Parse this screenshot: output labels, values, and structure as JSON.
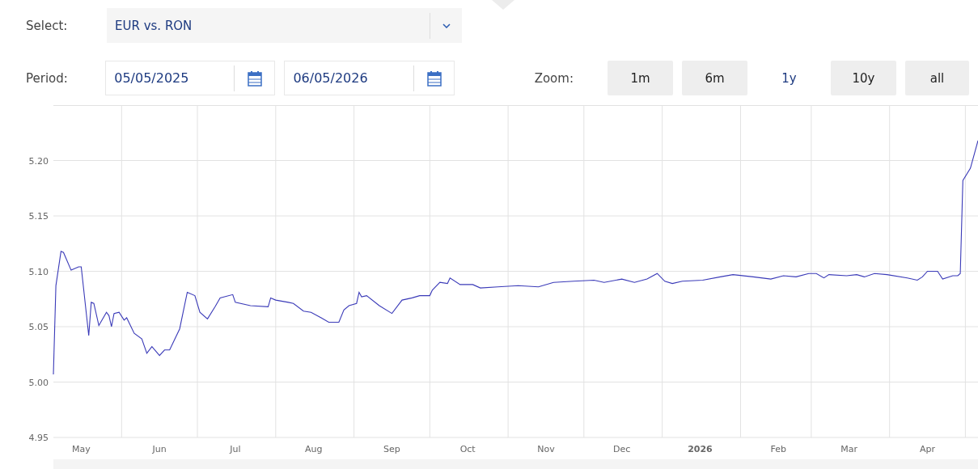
{
  "selector": {
    "label": "Select:",
    "value": "EUR vs. RON"
  },
  "period": {
    "label": "Period:",
    "from": "05/05/2025",
    "to": "06/05/2026"
  },
  "zoom": {
    "label": "Zoom:",
    "options": [
      {
        "label": "1m",
        "selected": false
      },
      {
        "label": "6m",
        "selected": false
      },
      {
        "label": "1y",
        "selected": true
      },
      {
        "label": "10y",
        "selected": false
      },
      {
        "label": "all",
        "selected": false
      }
    ]
  },
  "chart": {
    "chart_data": {
      "type": "line",
      "grid": true,
      "xlim": [
        "2025-05-05",
        "2026-05-06"
      ],
      "ylim": [
        4.95,
        5.25
      ],
      "yticks": [
        {
          "value": 4.95,
          "label": "4.95"
        },
        {
          "value": 5.0,
          "label": "5.00"
        },
        {
          "value": 5.05,
          "label": "5.05"
        },
        {
          "value": 5.1,
          "label": "5.10"
        },
        {
          "value": 5.15,
          "label": "5.15"
        },
        {
          "value": 5.2,
          "label": "5.20"
        }
      ],
      "xticks": [
        {
          "value": "2025-05-16",
          "label": "May"
        },
        {
          "value": "2025-06-16",
          "label": "Jun"
        },
        {
          "value": "2025-07-16",
          "label": "Jul"
        },
        {
          "value": "2025-08-16",
          "label": "Aug"
        },
        {
          "value": "2025-09-16",
          "label": "Sep"
        },
        {
          "value": "2025-10-16",
          "label": "Oct"
        },
        {
          "value": "2025-11-16",
          "label": "Nov"
        },
        {
          "value": "2025-12-16",
          "label": "Dec"
        },
        {
          "value": "2026-01-16",
          "label": "2026"
        },
        {
          "value": "2026-02-16",
          "label": "Feb"
        },
        {
          "value": "2026-03-16",
          "label": "Mar"
        },
        {
          "value": "2026-04-16",
          "label": "Apr"
        }
      ],
      "x": [
        "2025-05-05",
        "2025-05-06",
        "2025-05-08",
        "2025-05-09",
        "2025-05-12",
        "2025-05-15",
        "2025-05-16",
        "2025-05-19",
        "2025-05-20",
        "2025-05-21",
        "2025-05-23",
        "2025-05-26",
        "2025-05-27",
        "2025-05-28",
        "2025-05-29",
        "2025-05-31",
        "2025-06-02",
        "2025-06-03",
        "2025-06-06",
        "2025-06-09",
        "2025-06-11",
        "2025-06-13",
        "2025-06-16",
        "2025-06-18",
        "2025-06-20",
        "2025-06-24",
        "2025-06-27",
        "2025-06-30",
        "2025-07-02",
        "2025-07-05",
        "2025-07-08",
        "2025-07-10",
        "2025-07-15",
        "2025-07-16",
        "2025-07-22",
        "2025-07-29",
        "2025-07-30",
        "2025-08-01",
        "2025-08-06",
        "2025-08-08",
        "2025-08-12",
        "2025-08-15",
        "2025-08-19",
        "2025-08-22",
        "2025-08-26",
        "2025-08-28",
        "2025-08-30",
        "2025-09-02",
        "2025-09-03",
        "2025-09-04",
        "2025-09-06",
        "2025-09-11",
        "2025-09-16",
        "2025-09-20",
        "2025-09-24",
        "2025-09-27",
        "2025-10-01",
        "2025-10-02",
        "2025-10-05",
        "2025-10-08",
        "2025-10-09",
        "2025-10-13",
        "2025-10-18",
        "2025-10-21",
        "2025-10-28",
        "2025-11-05",
        "2025-11-13",
        "2025-11-19",
        "2025-11-27",
        "2025-12-05",
        "2025-12-09",
        "2025-12-16",
        "2025-12-21",
        "2025-12-26",
        "2025-12-30",
        "2026-01-02",
        "2026-01-05",
        "2026-01-09",
        "2026-01-17",
        "2026-01-24",
        "2026-01-29",
        "2026-02-06",
        "2026-02-13",
        "2026-02-18",
        "2026-02-23",
        "2026-02-28",
        "2026-03-03",
        "2026-03-06",
        "2026-03-08",
        "2026-03-15",
        "2026-03-19",
        "2026-03-22",
        "2026-03-26",
        "2026-03-31",
        "2026-04-08",
        "2026-04-12",
        "2026-04-14",
        "2026-04-16",
        "2026-04-20",
        "2026-04-22",
        "2026-04-26",
        "2026-04-28",
        "2026-04-29",
        "2026-04-30",
        "2026-05-03",
        "2026-05-06"
      ],
      "series": [
        {
          "color": "#3a3ab8",
          "values": [
            5.007,
            5.087,
            5.118,
            5.117,
            5.101,
            5.104,
            5.104,
            5.042,
            5.072,
            5.071,
            5.051,
            5.063,
            5.06,
            5.05,
            5.062,
            5.063,
            5.056,
            5.058,
            5.044,
            5.039,
            5.026,
            5.032,
            5.024,
            5.029,
            5.029,
            5.048,
            5.081,
            5.078,
            5.063,
            5.057,
            5.068,
            5.076,
            5.079,
            5.072,
            5.069,
            5.068,
            5.076,
            5.074,
            5.072,
            5.071,
            5.064,
            5.063,
            5.058,
            5.054,
            5.054,
            5.065,
            5.069,
            5.071,
            5.081,
            5.077,
            5.078,
            5.069,
            5.062,
            5.074,
            5.076,
            5.078,
            5.078,
            5.083,
            5.09,
            5.089,
            5.094,
            5.088,
            5.088,
            5.085,
            5.086,
            5.087,
            5.086,
            5.09,
            5.091,
            5.092,
            5.09,
            5.093,
            5.09,
            5.093,
            5.098,
            5.091,
            5.089,
            5.091,
            5.092,
            5.095,
            5.097,
            5.095,
            5.093,
            5.096,
            5.095,
            5.098,
            5.098,
            5.094,
            5.097,
            5.096,
            5.097,
            5.095,
            5.098,
            5.097,
            5.094,
            5.092,
            5.095,
            5.1,
            5.1,
            5.093,
            5.096,
            5.096,
            5.098,
            5.182,
            5.193,
            5.218
          ]
        }
      ]
    }
  }
}
